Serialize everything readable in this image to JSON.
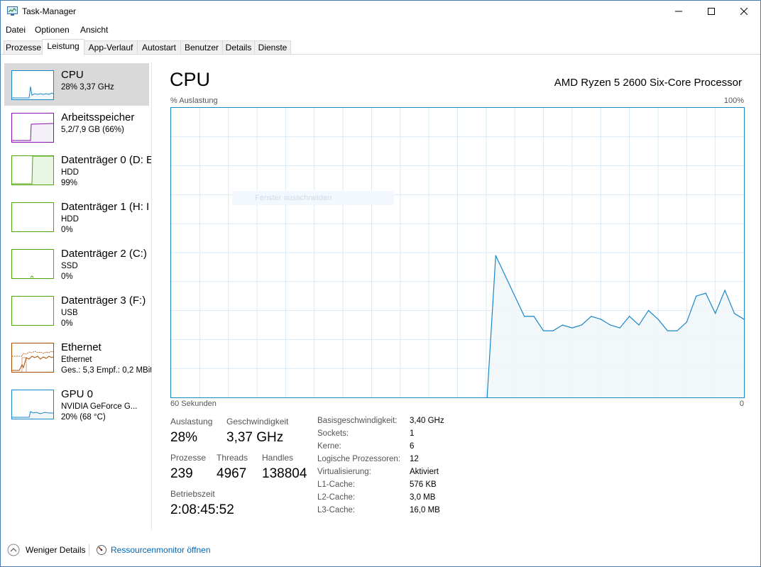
{
  "app": {
    "title": "Task-Manager"
  },
  "menu": [
    "Datei",
    "Optionen",
    "Ansicht"
  ],
  "tabs": [
    "Prozesse",
    "Leistung",
    "App-Verlauf",
    "Autostart",
    "Benutzer",
    "Details",
    "Dienste"
  ],
  "active_tab": "Leistung",
  "sidebar": {
    "items": [
      {
        "title": "CPU",
        "lines": [
          "28%  3,37 GHz"
        ],
        "color": "#1a86c8"
      },
      {
        "title": "Arbeitsspeicher",
        "lines": [
          "5,2/7,9 GB (66%)"
        ],
        "color": "#8b12ae"
      },
      {
        "title": "Datenträger 0 (D: E",
        "lines": [
          "HDD",
          "99%"
        ],
        "color": "#4da60c"
      },
      {
        "title": "Datenträger 1 (H: I",
        "lines": [
          "HDD",
          "0%"
        ],
        "color": "#4da60c"
      },
      {
        "title": "Datenträger 2 (C:)",
        "lines": [
          "SSD",
          "0%"
        ],
        "color": "#4da60c"
      },
      {
        "title": "Datenträger 3 (F:)",
        "lines": [
          "USB",
          "0%"
        ],
        "color": "#4da60c"
      },
      {
        "title": "Ethernet",
        "lines": [
          "Ethernet",
          "Ges.: 5,3  Empf.: 0,2 MBit"
        ],
        "color": "#a74f01"
      },
      {
        "title": "GPU 0",
        "lines": [
          "NVIDIA GeForce G...",
          "20% (68 °C)"
        ],
        "color": "#1a86c8"
      }
    ]
  },
  "main": {
    "title": "CPU",
    "processor": "AMD Ryzen 5 2600 Six-Core Processor",
    "graph_label": "% Auslastung",
    "graph_max": "100%",
    "graph_time": "60 Sekunden",
    "graph_min": "0",
    "ghost_text": "Fenster ausschneiden"
  },
  "stats": {
    "auslastung_label": "Auslastung",
    "auslastung": "28%",
    "geschwindigkeit_label": "Geschwindigkeit",
    "geschwindigkeit": "3,37 GHz",
    "prozesse_label": "Prozesse",
    "prozesse": "239",
    "threads_label": "Threads",
    "threads": "4967",
    "handles_label": "Handles",
    "handles": "138804",
    "betriebszeit_label": "Betriebszeit",
    "betriebszeit": "2:08:45:52"
  },
  "details": [
    {
      "label": "Basisgeschwindigkeit:",
      "value": "3,40 GHz"
    },
    {
      "label": "Sockets:",
      "value": "1"
    },
    {
      "label": "Kerne:",
      "value": "6"
    },
    {
      "label": "Logische Prozessoren:",
      "value": "12"
    },
    {
      "label": "Virtualisierung:",
      "value": "Aktiviert"
    },
    {
      "label": "L1-Cache:",
      "value": "576 KB"
    },
    {
      "label": "L2-Cache:",
      "value": "3,0 MB"
    },
    {
      "label": "L3-Cache:",
      "value": "16,0 MB"
    }
  ],
  "footer": {
    "less_details": "Weniger Details",
    "resource_monitor": "Ressourcenmonitor öffnen"
  },
  "chart_data": {
    "type": "area",
    "xlabel": "60 Sekunden",
    "ylabel": "% Auslastung",
    "ylim": [
      0,
      100
    ],
    "xlim": [
      60,
      0
    ],
    "grid": true,
    "series": [
      {
        "x": [
          26,
          25,
          24,
          23,
          22,
          21,
          20,
          19,
          18,
          17,
          16,
          15,
          14,
          13,
          12,
          11,
          10,
          9,
          8,
          7,
          6,
          5,
          4,
          3,
          2,
          1,
          0
        ],
        "values": [
          49,
          42,
          35,
          28,
          28,
          23,
          23,
          25,
          24,
          25,
          28,
          27,
          25,
          24,
          28,
          25,
          30,
          27,
          23,
          23,
          26,
          35,
          36,
          29,
          37,
          29,
          27
        ]
      }
    ]
  }
}
